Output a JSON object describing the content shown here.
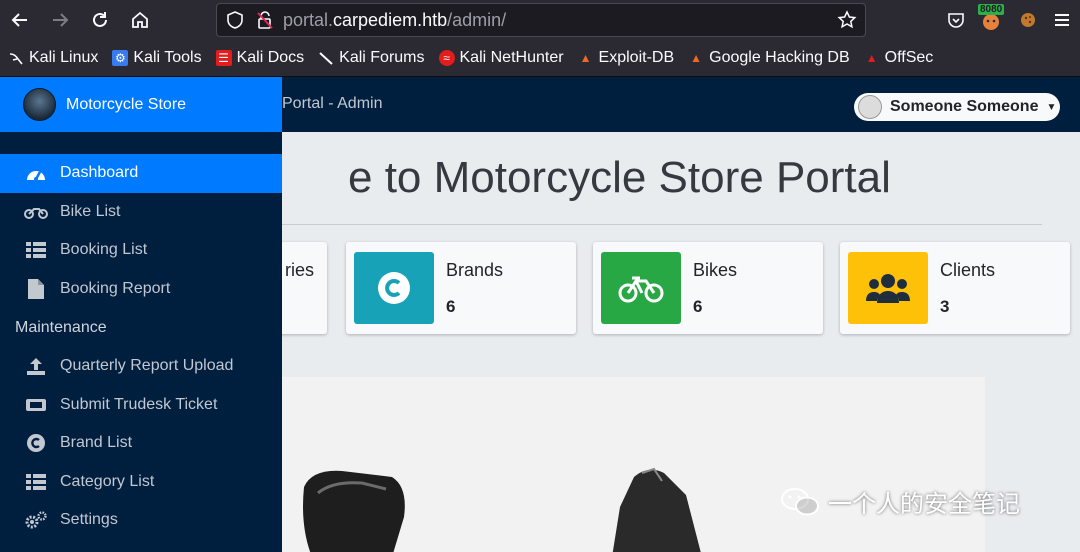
{
  "browser": {
    "url_prefix": "portal.",
    "url_host": "carpediem.htb",
    "url_path": "/admin/",
    "extension_badge": "8080",
    "bookmarks": [
      {
        "label": "Kali Linux",
        "icon": "kali-dragon-icon",
        "color": "#ffffff"
      },
      {
        "label": "Kali Tools",
        "icon": "kali-tools-icon",
        "color": "#367bf0"
      },
      {
        "label": "Kali Docs",
        "icon": "kali-docs-icon",
        "color": "#e11d1d"
      },
      {
        "label": "Kali Forums",
        "icon": "kali-forums-icon",
        "color": "#ffffff"
      },
      {
        "label": "Kali NetHunter",
        "icon": "nethunter-icon",
        "color": "#e11d1d"
      },
      {
        "label": "Exploit-DB",
        "icon": "exploit-db-icon",
        "color": "#f26822"
      },
      {
        "label": "Google Hacking DB",
        "icon": "ghdb-icon",
        "color": "#f26822"
      },
      {
        "label": "OffSec",
        "icon": "offsec-icon",
        "color": "#e11d1d"
      }
    ]
  },
  "sidebar": {
    "brand": "Motorcycle Store",
    "items": [
      {
        "label": "Dashboard",
        "icon": "dashboard-gauge-icon",
        "active": true
      },
      {
        "label": "Bike List",
        "icon": "motorcycle-icon"
      },
      {
        "label": "Booking List",
        "icon": "list-icon"
      },
      {
        "label": "Booking Report",
        "icon": "file-icon"
      }
    ],
    "section_header": "Maintenance",
    "maintenance_items": [
      {
        "label": "Quarterly Report Upload",
        "icon": "upload-icon"
      },
      {
        "label": "Submit Trudesk Ticket",
        "icon": "ticket-icon"
      },
      {
        "label": "Brand List",
        "icon": "copyright-icon"
      },
      {
        "label": "Category List",
        "icon": "list-icon"
      },
      {
        "label": "Settings",
        "icon": "cogs-icon"
      }
    ]
  },
  "header": {
    "title": "Portal - Admin",
    "user_name": "Someone Someone"
  },
  "main": {
    "welcome": "e to Motorcycle Store Portal",
    "cards": [
      {
        "label": "ries",
        "value": "",
        "icon": "",
        "color": "#ffffff"
      },
      {
        "label": "Brands",
        "value": "6",
        "icon": "copyright-icon",
        "color": "#17a2b8"
      },
      {
        "label": "Bikes",
        "value": "6",
        "icon": "bicycle-icon",
        "color": "#28a745"
      },
      {
        "label": "Clients",
        "value": "3",
        "icon": "users-icon",
        "color": "#ffc107"
      }
    ]
  },
  "watermark": "一个人的安全笔记"
}
